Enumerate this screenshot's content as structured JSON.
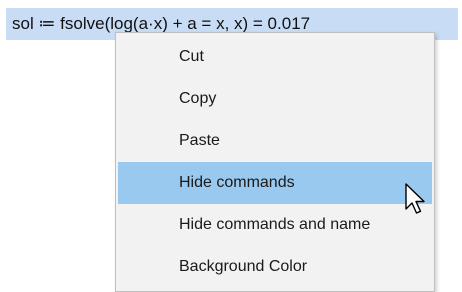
{
  "formula": {
    "text": "sol ≔ fsolve(log(a·x) + a = x, x) = 0.017"
  },
  "context_menu": {
    "items": [
      {
        "label": "Cut",
        "highlighted": false
      },
      {
        "label": "Copy",
        "highlighted": false
      },
      {
        "label": "Paste",
        "highlighted": false
      },
      {
        "label": "Hide commands",
        "highlighted": true
      },
      {
        "label": "Hide commands and name",
        "highlighted": false
      },
      {
        "label": "Background Color",
        "highlighted": false
      }
    ],
    "highlight_color": "#99c9ef",
    "background_color": "#f2f2f2"
  },
  "selection_color": "#c8ddf5",
  "cursor": {
    "icon": "arrow-pointer-icon"
  }
}
